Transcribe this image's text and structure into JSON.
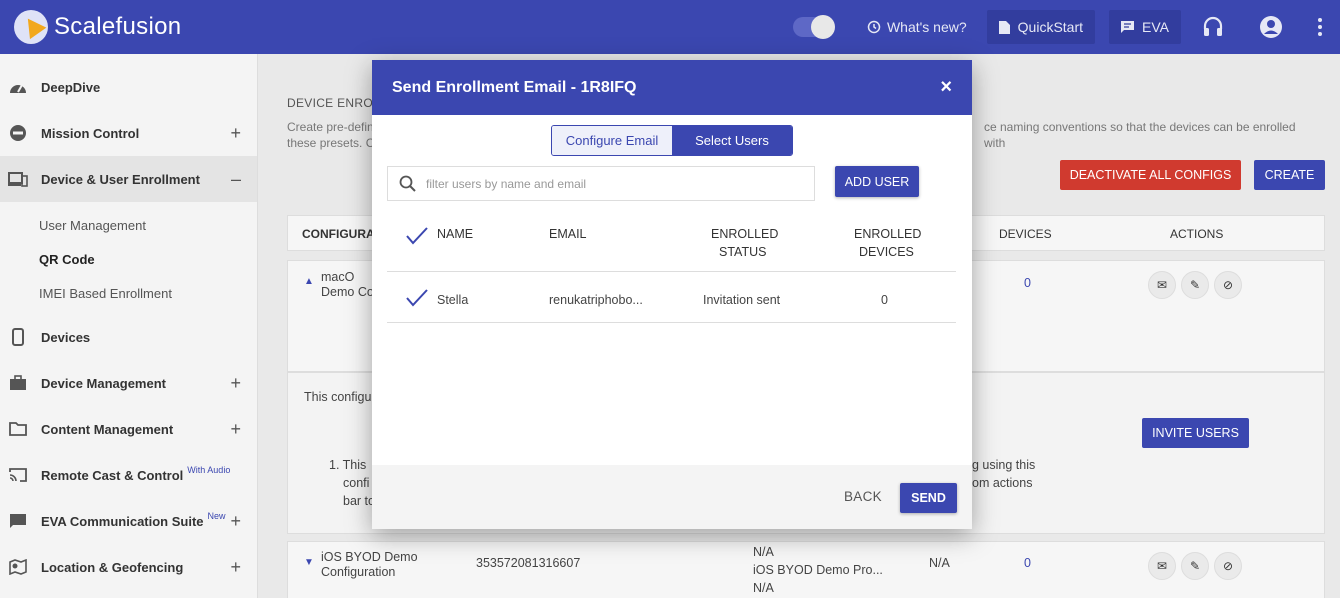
{
  "app": {
    "brand": "Scalefusion"
  },
  "topbar": {
    "whats_new": "What's new?",
    "quickstart": "QuickStart",
    "eva": "EVA"
  },
  "sidebar": {
    "items": [
      {
        "label": "DeepDive",
        "icon": "speedometer-icon"
      },
      {
        "label": "Mission Control",
        "icon": "control-icon",
        "toggle": "+"
      },
      {
        "label": "Device & User Enrollment",
        "icon": "devices-icon",
        "toggle": "–"
      },
      {
        "label": "Devices",
        "icon": "phone-icon"
      },
      {
        "label": "Device Management",
        "icon": "briefcase-icon",
        "toggle": "+"
      },
      {
        "label": "Content Management",
        "icon": "folder-icon",
        "toggle": "+"
      },
      {
        "label": "Remote Cast & Control",
        "icon": "cast-icon",
        "badge": "With Audio"
      },
      {
        "label": "EVA Communication Suite",
        "icon": "chat-icon",
        "badge": "New",
        "toggle": "+"
      },
      {
        "label": "Location & Geofencing",
        "icon": "map-icon",
        "toggle": "+"
      }
    ],
    "subitems": [
      "User Management",
      "QR Code",
      "IMEI Based Enrollment"
    ]
  },
  "background": {
    "section_title": "DEVICE ENRO",
    "desc_left": "Create pre-defin",
    "desc_left2": "these presets. C",
    "desc_right": "ce naming conventions so that the devices can be enrolled with",
    "deactivate_btn": "DEACTIVATE ALL CONFIGS",
    "create_btn": "CREATE",
    "table_headers": {
      "configuration": "CONFIGURAT",
      "devices": "DEVICES",
      "actions": "ACTIONS"
    },
    "row1": {
      "name": "macO",
      "name2": "Demo Co",
      "devices": "0"
    },
    "expanded": {
      "text1": "This configu",
      "list_prefix": "1. This",
      "list_line2": "confi",
      "list_line3": "bar to",
      "right1": "g using this",
      "right2": "om actions",
      "invite_btn": "INVITE USERS"
    },
    "row2": {
      "name": "iOS BYOD Demo",
      "name2": "Configuration",
      "code": "353572081316607",
      "p1": "N/A",
      "p2": "iOS BYOD Demo Pro...",
      "p3": "N/A",
      "na": "N/A",
      "devices": "0"
    }
  },
  "modal": {
    "title": "Send Enrollment Email - 1R8IFQ",
    "close": "×",
    "tabs": {
      "configure": "Configure Email",
      "select": "Select Users"
    },
    "search_placeholder": "filter users by name and email",
    "add_user": "ADD USER",
    "headers": {
      "name": "NAME",
      "email": "EMAIL",
      "enrolled_status_1": "ENROLLED",
      "enrolled_status_2": "STATUS",
      "enrolled_devices_1": "ENROLLED",
      "enrolled_devices_2": "DEVICES"
    },
    "rows": [
      {
        "name": "Stella",
        "email": "renukatriphobo...",
        "status": "Invitation sent",
        "devices": "0"
      }
    ],
    "back": "BACK",
    "send": "SEND"
  },
  "colors": {
    "brand": "#3b47b0",
    "danger": "#d03a2f"
  }
}
